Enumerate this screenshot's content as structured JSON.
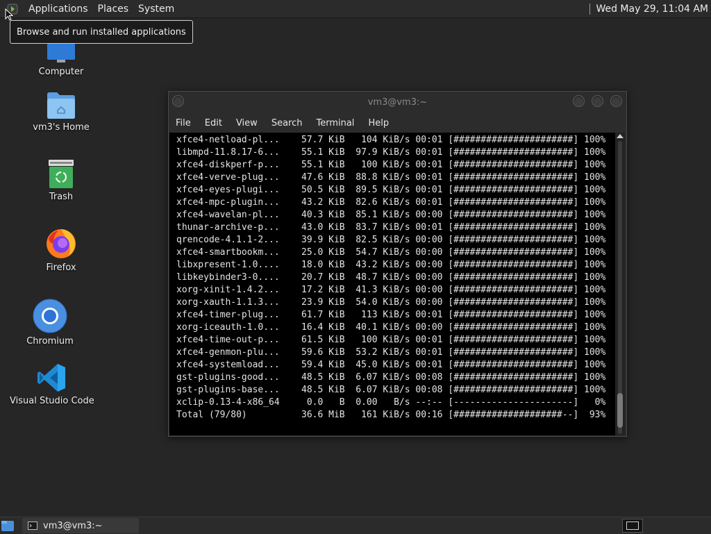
{
  "top_panel": {
    "menus": [
      "Applications",
      "Places",
      "System"
    ],
    "clock": "Wed May 29, 11:04 AM"
  },
  "tooltip": "Browse and run installed applications",
  "desktop_icons": [
    {
      "label": "Computer",
      "icon": "computer-icon"
    },
    {
      "label": "vm3's Home",
      "icon": "home-folder-icon"
    },
    {
      "label": "Trash",
      "icon": "trash-icon"
    },
    {
      "label": "Firefox",
      "icon": "firefox-icon"
    },
    {
      "label": "Chromium",
      "icon": "chromium-icon"
    },
    {
      "label": "Visual Studio Code",
      "icon": "vscode-icon"
    }
  ],
  "terminal": {
    "title": "vm3@vm3:~",
    "menu": [
      "File",
      "Edit",
      "View",
      "Search",
      "Terminal",
      "Help"
    ],
    "lines": [
      "xfce4-netload-pl...    57.7 KiB   104 KiB/s 00:01 [######################] 100%",
      "libmpd-11.8.17-6...    55.1 KiB  97.9 KiB/s 00:01 [######################] 100%",
      "xfce4-diskperf-p...    55.1 KiB   100 KiB/s 00:01 [######################] 100%",
      "xfce4-verve-plug...    47.6 KiB  88.8 KiB/s 00:01 [######################] 100%",
      "xfce4-eyes-plugi...    50.5 KiB  89.5 KiB/s 00:01 [######################] 100%",
      "xfce4-mpc-plugin...    43.2 KiB  82.6 KiB/s 00:01 [######################] 100%",
      "xfce4-wavelan-pl...    40.3 KiB  85.1 KiB/s 00:00 [######################] 100%",
      "thunar-archive-p...    43.0 KiB  83.7 KiB/s 00:01 [######################] 100%",
      "qrencode-4.1.1-2...    39.9 KiB  82.5 KiB/s 00:00 [######################] 100%",
      "xfce4-smartbookm...    25.0 KiB  54.7 KiB/s 00:00 [######################] 100%",
      "libxpresent-1.0....    18.0 KiB  43.2 KiB/s 00:00 [######################] 100%",
      "libkeybinder3-0....    20.7 KiB  48.7 KiB/s 00:00 [######################] 100%",
      "xorg-xinit-1.4.2...    17.2 KiB  41.3 KiB/s 00:00 [######################] 100%",
      "xorg-xauth-1.1.3...    23.9 KiB  54.0 KiB/s 00:00 [######################] 100%",
      "xfce4-timer-plug...    61.7 KiB   113 KiB/s 00:01 [######################] 100%",
      "xorg-iceauth-1.0...    16.4 KiB  40.1 KiB/s 00:00 [######################] 100%",
      "xfce4-time-out-p...    61.5 KiB   100 KiB/s 00:01 [######################] 100%",
      "xfce4-genmon-plu...    59.6 KiB  53.2 KiB/s 00:01 [######################] 100%",
      "xfce4-systemload...    59.4 KiB  45.0 KiB/s 00:01 [######################] 100%",
      "gst-plugins-good...    48.5 KiB  6.07 KiB/s 00:08 [######################] 100%",
      "gst-plugins-base...    48.5 KiB  6.07 KiB/s 00:08 [######################] 100%",
      "xclip-0.13-4-x86_64     0.0   B  0.00   B/s --:-- [----------------------]   0%",
      "Total (79/80)          36.6 MiB   161 KiB/s 00:16 [####################--]  93%"
    ]
  },
  "taskbar": {
    "task_label": "vm3@vm3:~"
  }
}
